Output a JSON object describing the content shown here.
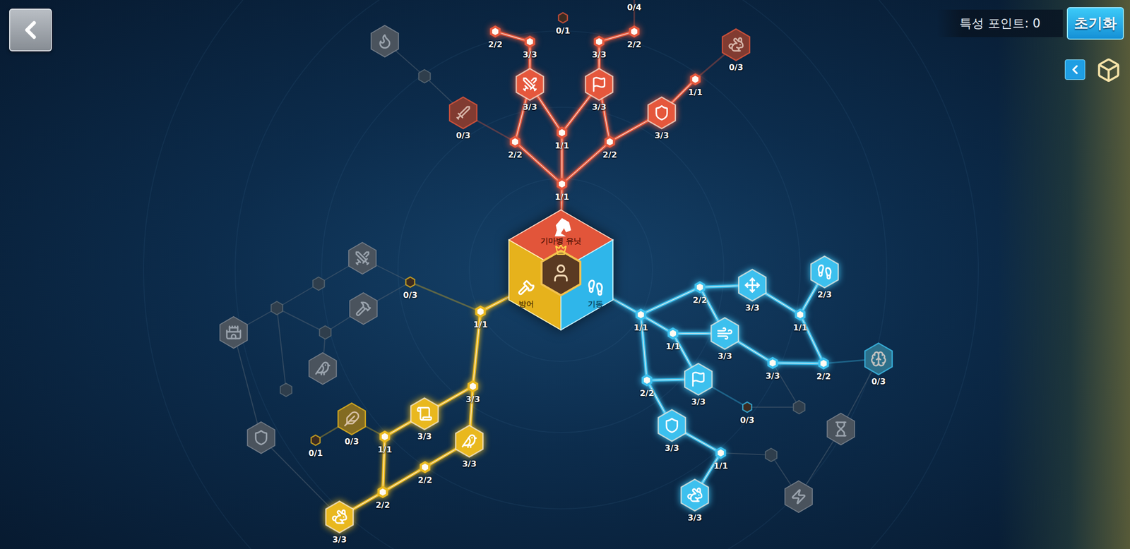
{
  "header": {
    "points_label": "특성 포인트: 0",
    "reset_button": "초기화"
  },
  "hub": {
    "top": {
      "label": "기마병 유닛",
      "color": "#e2553a"
    },
    "left": {
      "label": "방어",
      "color": "#e6b21c"
    },
    "right": {
      "label": "기동",
      "color": "#2fb6ea"
    }
  },
  "nodes": [
    {
      "label": "1/1",
      "kind": "step",
      "active": true,
      "locked": false,
      "color": "#e5573c"
    },
    {
      "label": "2/2",
      "kind": "step",
      "active": true,
      "locked": false,
      "color": "#e5573c"
    },
    {
      "label": "1/1",
      "kind": "step",
      "active": true,
      "locked": false,
      "color": "#e5573c"
    },
    {
      "label": "2/2",
      "kind": "step",
      "active": true,
      "locked": false,
      "color": "#e5573c"
    },
    {
      "label": "3/3",
      "kind": "talent",
      "active": true,
      "locked": false,
      "color": "#e5573c"
    },
    {
      "label": "3/3",
      "kind": "talent",
      "active": true,
      "locked": false,
      "color": "#e5573c"
    },
    {
      "label": "3/3",
      "kind": "talent",
      "active": true,
      "locked": false,
      "color": "#e5573c"
    },
    {
      "label": "2/2",
      "kind": "step",
      "active": true,
      "locked": false,
      "color": "#e5573c"
    },
    {
      "label": "3/3",
      "kind": "step",
      "active": true,
      "locked": false,
      "color": "#e5573c"
    },
    {
      "label": "0/1",
      "kind": "step",
      "active": false,
      "locked": false,
      "color": "#e5573c"
    },
    {
      "label": "3/3",
      "kind": "step",
      "active": true,
      "locked": false,
      "color": "#e5573c"
    },
    {
      "label": "2/2",
      "kind": "step",
      "active": true,
      "locked": false,
      "color": "#e5573c"
    },
    {
      "label": "0/4",
      "kind": "step",
      "active": false,
      "locked": false,
      "color": "#e5573c"
    },
    {
      "label": "1/1",
      "kind": "step",
      "active": true,
      "locked": false,
      "color": "#e5573c"
    },
    {
      "label": "0/3",
      "kind": "talent",
      "active": false,
      "locked": false,
      "color": "#e5573c"
    },
    {
      "label": "0/3",
      "kind": "talent",
      "active": false,
      "locked": false,
      "color": "#e5573c"
    },
    {
      "kind": "talent",
      "active": false,
      "locked": true
    },
    {
      "kind": "step",
      "active": false,
      "locked": true
    },
    {
      "label": "1/1",
      "kind": "step",
      "active": true,
      "locked": false,
      "color": "#e9b81e"
    },
    {
      "label": "3/3",
      "kind": "step",
      "active": true,
      "locked": false,
      "color": "#e9b81e"
    },
    {
      "label": "3/3",
      "kind": "talent",
      "active": true,
      "locked": false,
      "color": "#e9b81e"
    },
    {
      "label": "3/3",
      "kind": "talent",
      "active": true,
      "locked": false,
      "color": "#e9b81e"
    },
    {
      "label": "1/1",
      "kind": "step",
      "active": true,
      "locked": false,
      "color": "#e9b81e"
    },
    {
      "label": "2/2",
      "kind": "step",
      "active": true,
      "locked": false,
      "color": "#e9b81e"
    },
    {
      "label": "2/2",
      "kind": "step",
      "active": true,
      "locked": false,
      "color": "#e9b81e"
    },
    {
      "label": "3/3",
      "kind": "talent",
      "active": true,
      "locked": false,
      "color": "#e9b81e"
    },
    {
      "label": "0/3",
      "kind": "talent",
      "active": false,
      "locked": false,
      "color": "#e9b81e"
    },
    {
      "label": "0/1",
      "kind": "step",
      "active": false,
      "locked": false,
      "color": "#e9b81e"
    },
    {
      "label": "0/3",
      "kind": "step",
      "active": false,
      "locked": false,
      "color": "#e9b81e"
    },
    {
      "kind": "talent",
      "active": false,
      "locked": true
    },
    {
      "kind": "step",
      "active": false,
      "locked": true
    },
    {
      "kind": "step",
      "active": false,
      "locked": true
    },
    {
      "kind": "talent",
      "active": false,
      "locked": true
    },
    {
      "kind": "step",
      "active": false,
      "locked": true
    },
    {
      "kind": "talent",
      "active": false,
      "locked": true
    },
    {
      "kind": "talent",
      "active": false,
      "locked": true
    },
    {
      "kind": "step",
      "active": false,
      "locked": true
    },
    {
      "kind": "talent",
      "active": false,
      "locked": true
    },
    {
      "label": "1/1",
      "kind": "step",
      "active": true,
      "locked": false,
      "color": "#3cc0ee"
    },
    {
      "label": "2/2",
      "kind": "step",
      "active": true,
      "locked": false,
      "color": "#3cc0ee"
    },
    {
      "label": "3/3",
      "kind": "talent",
      "active": true,
      "locked": false,
      "color": "#3cc0ee"
    },
    {
      "label": "2/3",
      "kind": "talent",
      "active": true,
      "locked": false,
      "color": "#3cc0ee"
    },
    {
      "label": "1/1",
      "kind": "step",
      "active": true,
      "locked": false,
      "color": "#3cc0ee"
    },
    {
      "label": "1/1",
      "kind": "step",
      "active": true,
      "locked": false,
      "color": "#3cc0ee"
    },
    {
      "label": "3/3",
      "kind": "talent",
      "active": true,
      "locked": false,
      "color": "#3cc0ee"
    },
    {
      "label": "3/3",
      "kind": "step",
      "active": true,
      "locked": false,
      "color": "#3cc0ee"
    },
    {
      "label": "2/2",
      "kind": "step",
      "active": true,
      "locked": false,
      "color": "#3cc0ee"
    },
    {
      "label": "0/3",
      "kind": "talent",
      "active": false,
      "locked": false,
      "color": "#3cc0ee"
    },
    {
      "label": "2/2",
      "kind": "step",
      "active": true,
      "locked": false,
      "color": "#3cc0ee"
    },
    {
      "label": "3/3",
      "kind": "talent",
      "active": true,
      "locked": false,
      "color": "#3cc0ee"
    },
    {
      "label": "0/3",
      "kind": "step",
      "active": false,
      "locked": false,
      "color": "#3cc0ee"
    },
    {
      "kind": "step",
      "active": false,
      "locked": true
    },
    {
      "label": "3/3",
      "kind": "talent",
      "active": true,
      "locked": false,
      "color": "#3cc0ee"
    },
    {
      "label": "1/1",
      "kind": "step",
      "active": true,
      "locked": false,
      "color": "#3cc0ee"
    },
    {
      "kind": "step",
      "active": false,
      "locked": true
    },
    {
      "kind": "talent",
      "active": false,
      "locked": true
    },
    {
      "label": "3/3",
      "kind": "talent",
      "active": true,
      "locked": false,
      "color": "#3cc0ee"
    },
    {
      "kind": "talent",
      "active": false,
      "locked": true
    }
  ]
}
